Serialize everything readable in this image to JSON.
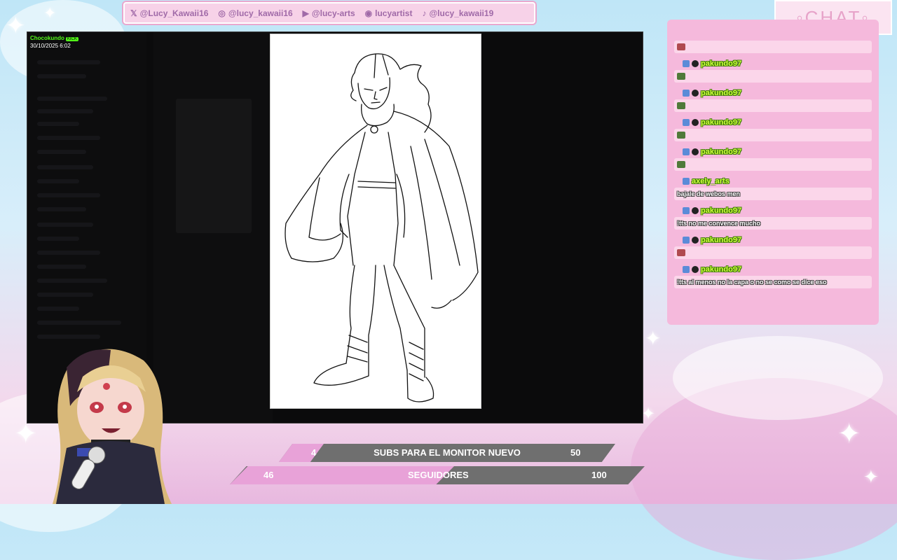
{
  "social": [
    {
      "icon": "x-icon",
      "glyph": "𝕏",
      "handle": "@Lucy_Kawaii16"
    },
    {
      "icon": "instagram-icon",
      "glyph": "◎",
      "handle": "@lucy_kawaii16"
    },
    {
      "icon": "youtube-icon",
      "glyph": "▶",
      "handle": "@lucy-arts"
    },
    {
      "icon": "discord-icon",
      "glyph": "◉",
      "handle": "lucyartist"
    },
    {
      "icon": "tiktok-icon",
      "glyph": "♪",
      "handle": "@lucy_kawaii19"
    }
  ],
  "window": {
    "streamer_tag": "Chocokundo",
    "kick_badge": "KICK",
    "date_stamp": "30/10/2025 6:02"
  },
  "chat": {
    "title": "◦CHAT◦",
    "messages": [
      {
        "user": "",
        "text": "",
        "emote": "red"
      },
      {
        "user": "pakundo97",
        "text": "",
        "emote": "green"
      },
      {
        "user": "pakundo97",
        "text": "",
        "emote": "green"
      },
      {
        "user": "pakundo97",
        "text": "",
        "emote": "green"
      },
      {
        "user": "pakundo97",
        "text": "",
        "emote": "green"
      },
      {
        "user": "axely_arts",
        "text": "bajale de webos men",
        "emote": ""
      },
      {
        "user": "pakundo97",
        "text": "!tts no me convence mucho",
        "emote": ""
      },
      {
        "user": "pakundo97",
        "text": "",
        "emote": "red"
      },
      {
        "user": "pakundo97",
        "text": "!tts al menos no la capa o no se como se dice eso",
        "emote": ""
      }
    ]
  },
  "goals": [
    {
      "current": "4",
      "label": "SUBS PARA EL MONITOR NUEVO",
      "target": "50",
      "progress": 0.08
    },
    {
      "current": "46",
      "label": "SEGUIDORES",
      "target": "100",
      "progress": 0.46
    }
  ],
  "colors": {
    "accent_pink": "#e8a2d8",
    "chat_bg": "#f5b9dc",
    "username_green": "#cfff3f"
  }
}
